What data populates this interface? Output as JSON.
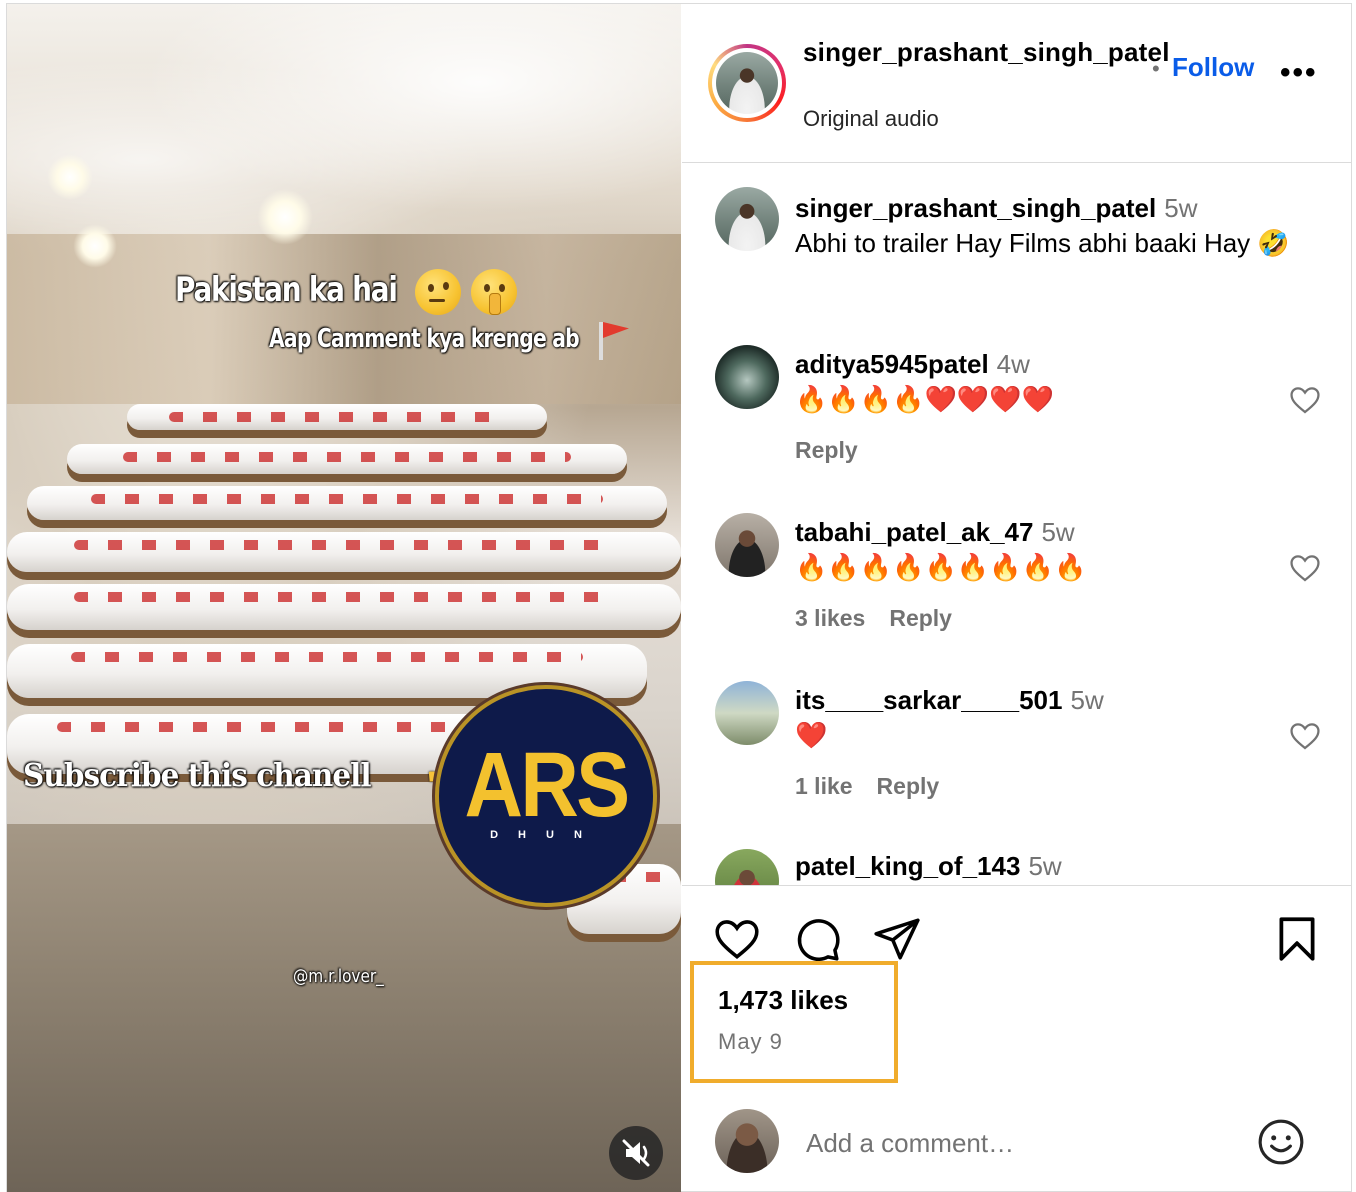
{
  "post": {
    "media_overlay": {
      "line1": "Pakistan ka hai",
      "line2": "Aap Camment kya krenge ab",
      "subscribe": "Subscribe this chanell",
      "logo_main": "ARS",
      "logo_sub": "DHUN",
      "watermark": "@m.r.lover_"
    },
    "header": {
      "username": "singer_prashant_singh_patel",
      "separator": "•",
      "follow_label": "Follow",
      "subtitle": "Original audio",
      "more_label": "•••"
    },
    "comments": [
      {
        "user": "singer_prashant_singh_patel",
        "time": "5w",
        "text": "Abhi to trailer Hay Films abhi baaki Hay 🤣",
        "likes": "",
        "reply": ""
      },
      {
        "user": "aditya5945patel",
        "time": "4w",
        "text": "🔥🔥🔥🔥❤️❤️❤️❤️",
        "likes": "",
        "reply": "Reply"
      },
      {
        "user": "tabahi_patel_ak_47",
        "time": "5w",
        "text": "🔥🔥🔥🔥🔥🔥🔥🔥🔥",
        "likes": "3 likes",
        "reply": "Reply"
      },
      {
        "user": "its____sarkar____501",
        "time": "5w",
        "text": "❤️",
        "likes": "1 like",
        "reply": "Reply"
      },
      {
        "user": "patel_king_of_143",
        "time": "5w",
        "text": "",
        "likes": "",
        "reply": ""
      }
    ],
    "actions": {
      "likes": "1,473 likes",
      "date": "May 9"
    },
    "add_comment": {
      "placeholder": "Add a comment…"
    },
    "colors": {
      "follow_blue": "#0a5ce8",
      "highlight_box": "#f0ac2c",
      "muted_text": "#737373"
    },
    "icons": [
      "like-heart-icon",
      "comment-bubble-icon",
      "share-paper-plane-icon",
      "save-bookmark-icon",
      "emoji-smile-icon",
      "muted-speaker-icon",
      "more-options-icon"
    ]
  }
}
